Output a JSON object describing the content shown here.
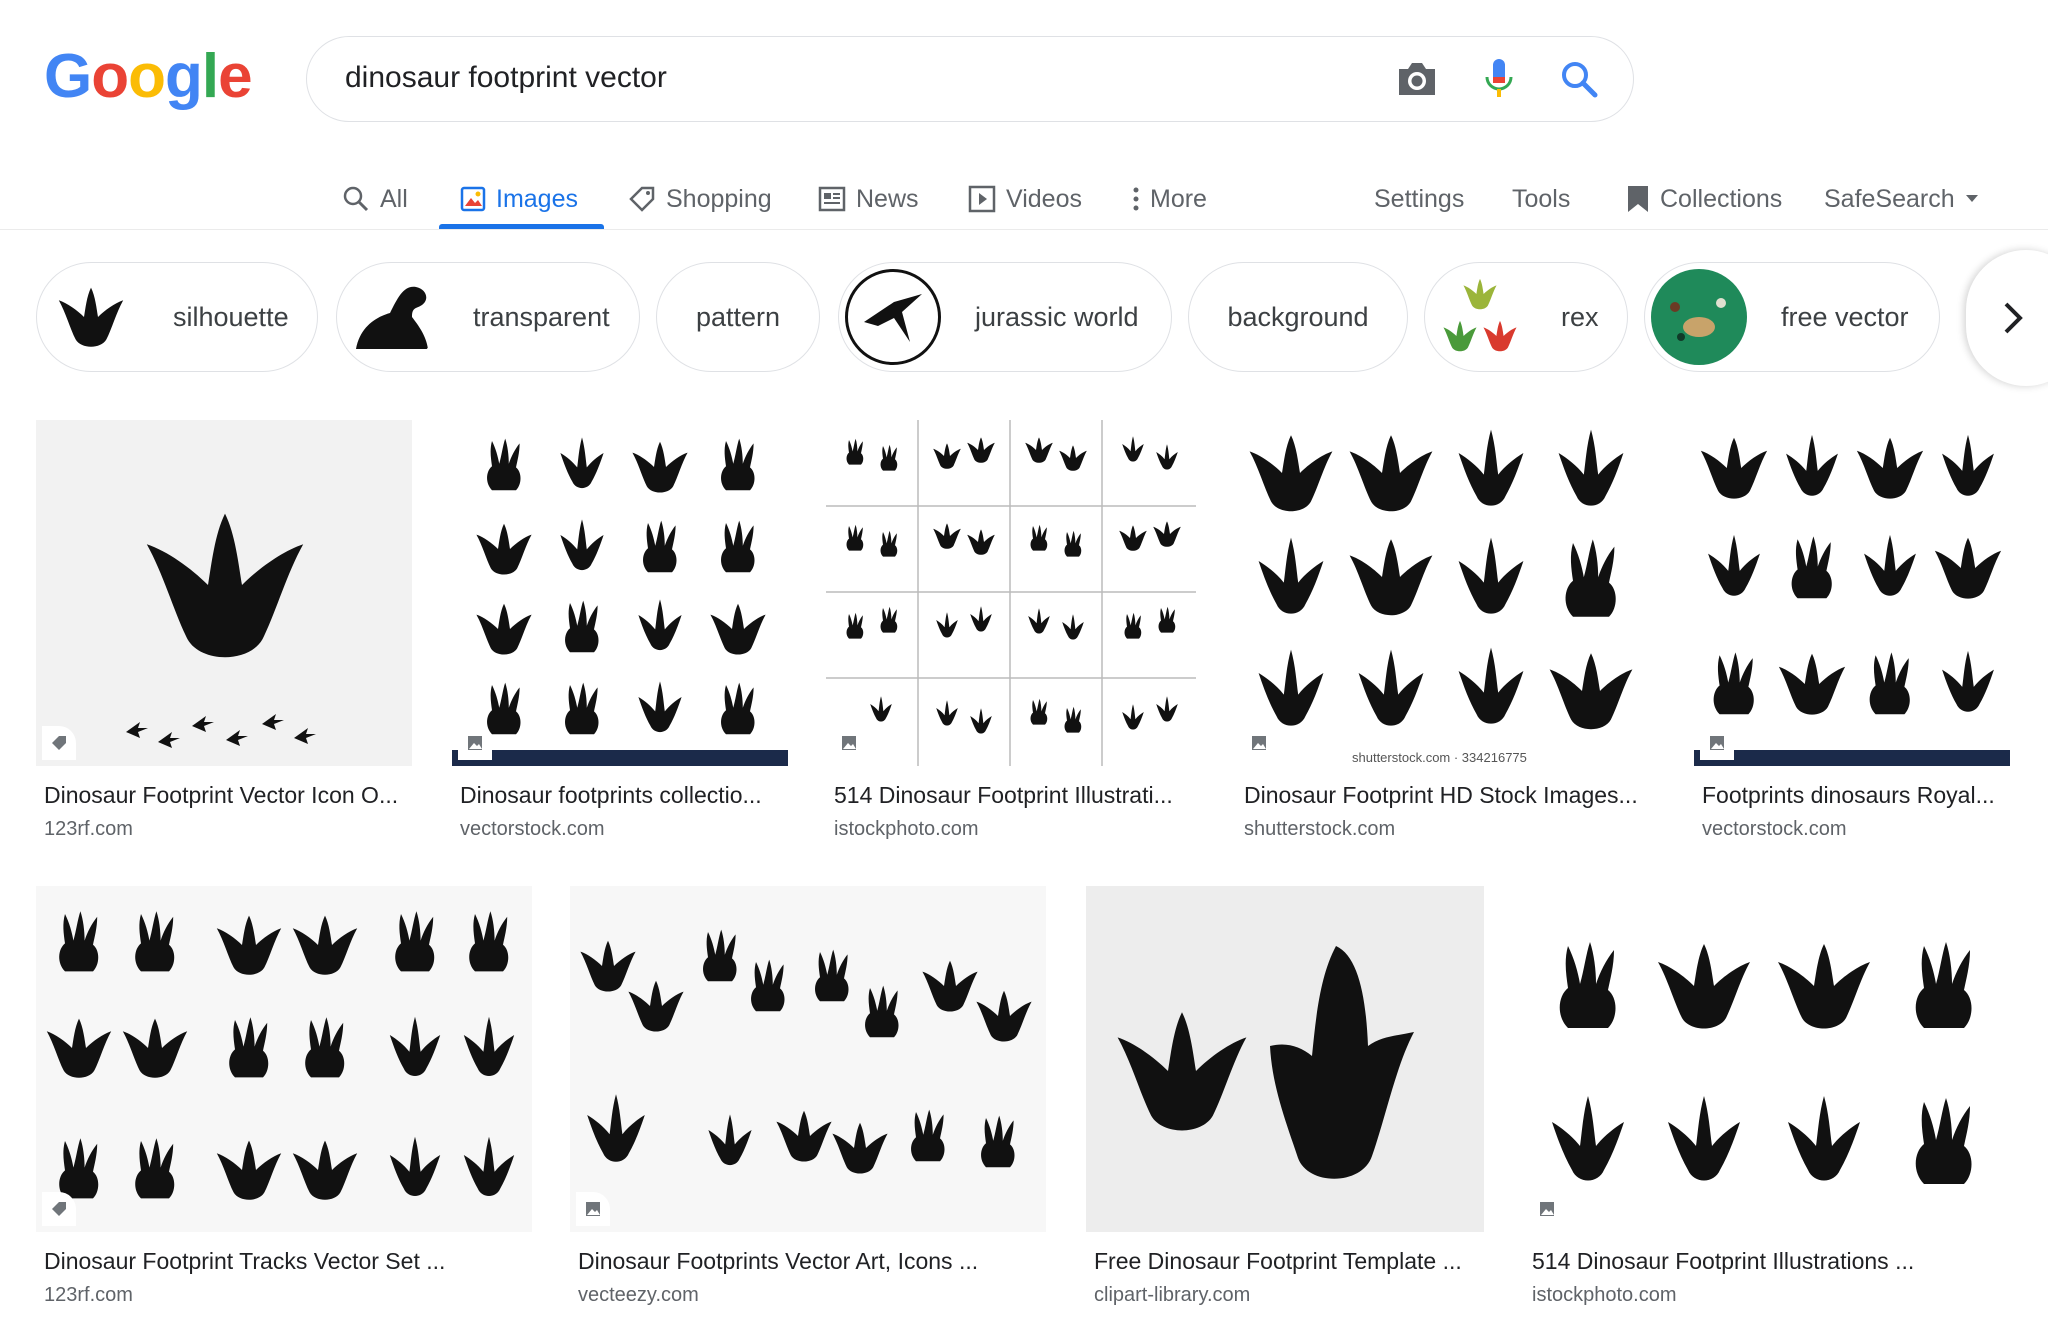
{
  "search": {
    "query": "dinosaur footprint vector",
    "camera_icon": "camera-icon",
    "mic_icon": "microphone-icon",
    "search_icon": "search-icon"
  },
  "logo": {
    "text": "Google",
    "letters": [
      "G",
      "o",
      "o",
      "g",
      "l",
      "e"
    ],
    "colors": [
      "#4285F4",
      "#EA4335",
      "#FBBC05",
      "#4285F4",
      "#34A853",
      "#EA4335"
    ]
  },
  "tabs": {
    "all": "All",
    "images": "Images",
    "shopping": "Shopping",
    "news": "News",
    "videos": "Videos",
    "more": "More",
    "settings": "Settings",
    "tools": "Tools",
    "collections": "Collections",
    "safesearch": "SafeSearch"
  },
  "chips": [
    {
      "label": "silhouette"
    },
    {
      "label": "transparent"
    },
    {
      "label": "pattern"
    },
    {
      "label": "jurassic world"
    },
    {
      "label": "background"
    },
    {
      "label": "rex"
    },
    {
      "label": "free vector"
    }
  ],
  "results": [
    {
      "title": "Dinosaur Footprint Vector Icon O...",
      "source": "123rf.com"
    },
    {
      "title": "Dinosaur footprints collectio...",
      "source": "vectorstock.com"
    },
    {
      "title": "514 Dinosaur Footprint Illustrati...",
      "source": "istockphoto.com"
    },
    {
      "title": "Dinosaur Footprint HD Stock Images...",
      "source": "shutterstock.com"
    },
    {
      "title": "Footprints dinosaurs Royal...",
      "source": "vectorstock.com"
    },
    {
      "title": "Dinosaur Footprint Tracks Vector Set ...",
      "source": "123rf.com"
    },
    {
      "title": "Dinosaur Footprints Vector Art, Icons ...",
      "source": "vecteezy.com"
    },
    {
      "title": "Free Dinosaur Footprint Template ...",
      "source": "clipart-library.com"
    },
    {
      "title": "514 Dinosaur Footprint Illustrations ...",
      "source": "istockphoto.com"
    }
  ],
  "colors": {
    "accent": "#1a73e8",
    "text": "#202124",
    "secondary": "#5f6368"
  }
}
